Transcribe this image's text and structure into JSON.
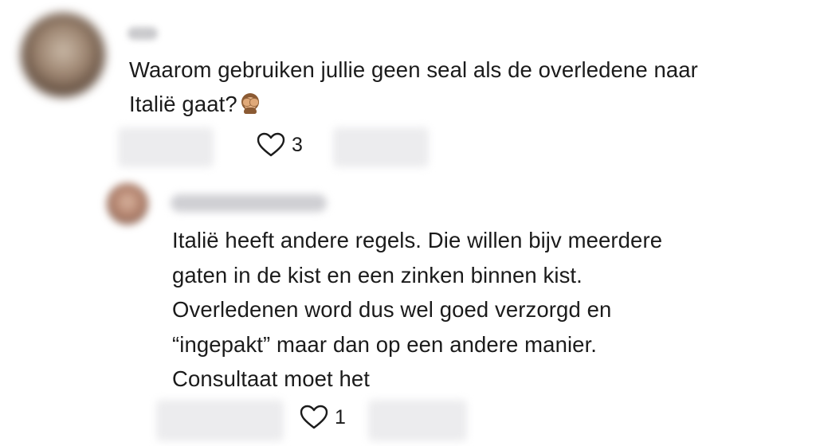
{
  "comment": {
    "line1": "Waarom gebruiken jullie geen seal als de overledene naar",
    "line2": "Italië gaat?",
    "emoji": "see-no-evil-monkey",
    "likes": "3"
  },
  "reply": {
    "lines": [
      "Italië heeft andere regels. Die willen bijv meerdere",
      "gaten in de kist en een zinken binnen kist.",
      "Overledenen word dus wel goed verzorgd en",
      "“ingepakt” maar dan op een andere manier.",
      "Consultaat moet het"
    ],
    "likes": "1"
  },
  "colors": {
    "text": "#1b1b1b",
    "background": "#ffffff",
    "blur": "#ececee"
  }
}
